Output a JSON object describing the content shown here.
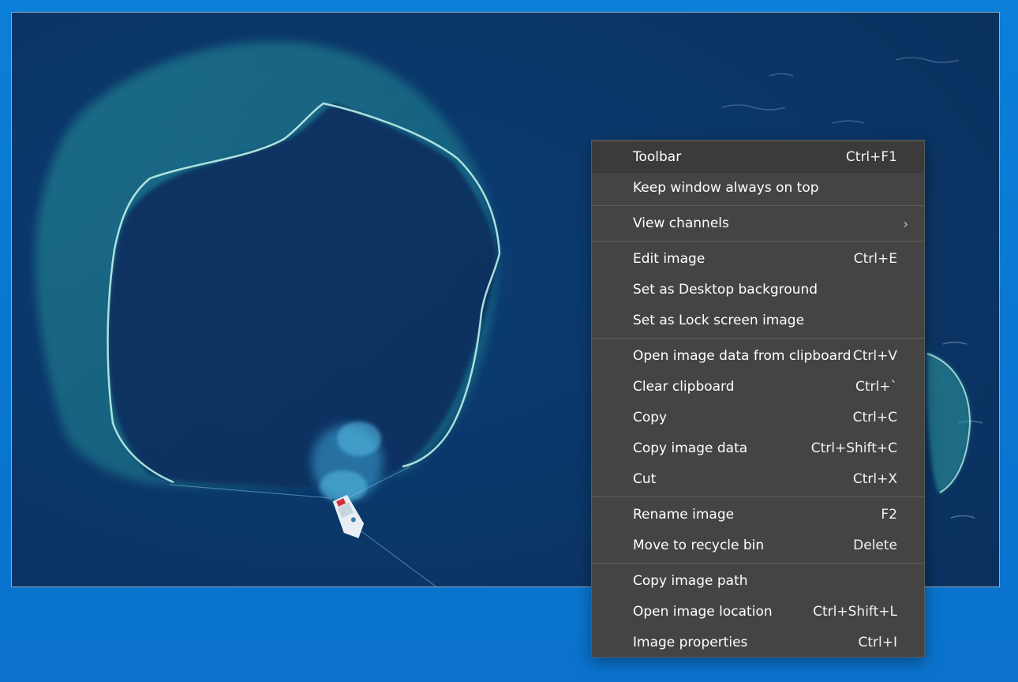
{
  "viewer": {
    "image_alt": "Aerial view of a fishing boat with a circular net on deep blue sea"
  },
  "context_menu": {
    "groups": [
      [
        {
          "label": "Toolbar",
          "shortcut": "Ctrl+F1"
        },
        {
          "label": "Keep window always on top",
          "shortcut": ""
        }
      ],
      [
        {
          "label": "View channels",
          "shortcut": "",
          "submenu_icon": "chevron-right-icon"
        }
      ],
      [
        {
          "label": "Edit image",
          "shortcut": "Ctrl+E"
        },
        {
          "label": "Set as Desktop background",
          "shortcut": ""
        },
        {
          "label": "Set as Lock screen image",
          "shortcut": ""
        }
      ],
      [
        {
          "label": "Open image data from clipboard",
          "shortcut": "Ctrl+V"
        },
        {
          "label": "Clear clipboard",
          "shortcut": "Ctrl+`"
        },
        {
          "label": "Copy",
          "shortcut": "Ctrl+C"
        },
        {
          "label": "Copy image data",
          "shortcut": "Ctrl+Shift+C"
        },
        {
          "label": "Cut",
          "shortcut": "Ctrl+X"
        }
      ],
      [
        {
          "label": "Rename image",
          "shortcut": "F2"
        },
        {
          "label": "Move to recycle bin",
          "shortcut": "Delete"
        }
      ],
      [
        {
          "label": "Copy image path",
          "shortcut": ""
        },
        {
          "label": "Open image location",
          "shortcut": "Ctrl+Shift+L"
        },
        {
          "label": "Image properties",
          "shortcut": "Ctrl+I"
        }
      ]
    ],
    "submenu_arrow_glyph": "›"
  },
  "colors": {
    "menu_background": "#434443",
    "menu_highlight": "#3a3b3a",
    "desktop_background": "#0a78d4",
    "sea_color": "#0b3566"
  }
}
